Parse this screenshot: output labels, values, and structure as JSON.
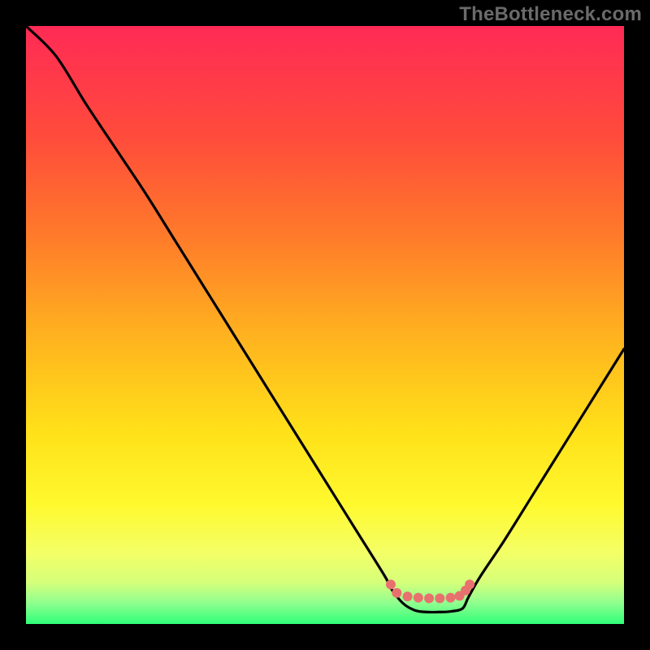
{
  "watermark": "TheBottleneck.com",
  "colors": {
    "frame": "#000000",
    "curve": "#000000",
    "markers": "#e8716f",
    "gradient_stops": [
      {
        "offset": 0.0,
        "color": "#ff2a55"
      },
      {
        "offset": 0.18,
        "color": "#ff4a3c"
      },
      {
        "offset": 0.35,
        "color": "#ff7a2a"
      },
      {
        "offset": 0.52,
        "color": "#ffb31f"
      },
      {
        "offset": 0.68,
        "color": "#ffe119"
      },
      {
        "offset": 0.8,
        "color": "#fff92e"
      },
      {
        "offset": 0.88,
        "color": "#f4ff66"
      },
      {
        "offset": 0.93,
        "color": "#d6ff7a"
      },
      {
        "offset": 0.965,
        "color": "#8fff8f"
      },
      {
        "offset": 1.0,
        "color": "#2fff78"
      }
    ]
  },
  "chart_data": {
    "type": "line",
    "title": "",
    "xlabel": "",
    "ylabel": "",
    "xlim": [
      0,
      100
    ],
    "ylim": [
      0,
      100
    ],
    "grid": false,
    "legend": false,
    "series": [
      {
        "name": "bottleneck-curve",
        "x": [
          0,
          5,
          10,
          15,
          20,
          25,
          30,
          35,
          40,
          45,
          50,
          55,
          60,
          61,
          63,
          65,
          67,
          69,
          71,
          73,
          74,
          76,
          80,
          85,
          90,
          95,
          100
        ],
        "y": [
          100,
          95,
          87,
          79.5,
          72,
          64,
          56,
          48,
          40,
          32,
          24,
          16,
          8,
          6,
          3.5,
          2.3,
          2,
          2,
          2.1,
          2.6,
          4.5,
          8,
          14,
          22,
          30,
          38,
          46
        ]
      }
    ],
    "markers": {
      "name": "optimum-range",
      "x": [
        61.0,
        62.0,
        63.8,
        65.6,
        67.4,
        69.2,
        71.0,
        72.5,
        73.5,
        74.2
      ],
      "y": [
        6.6,
        5.2,
        4.6,
        4.4,
        4.3,
        4.3,
        4.4,
        4.7,
        5.6,
        6.6
      ]
    }
  }
}
